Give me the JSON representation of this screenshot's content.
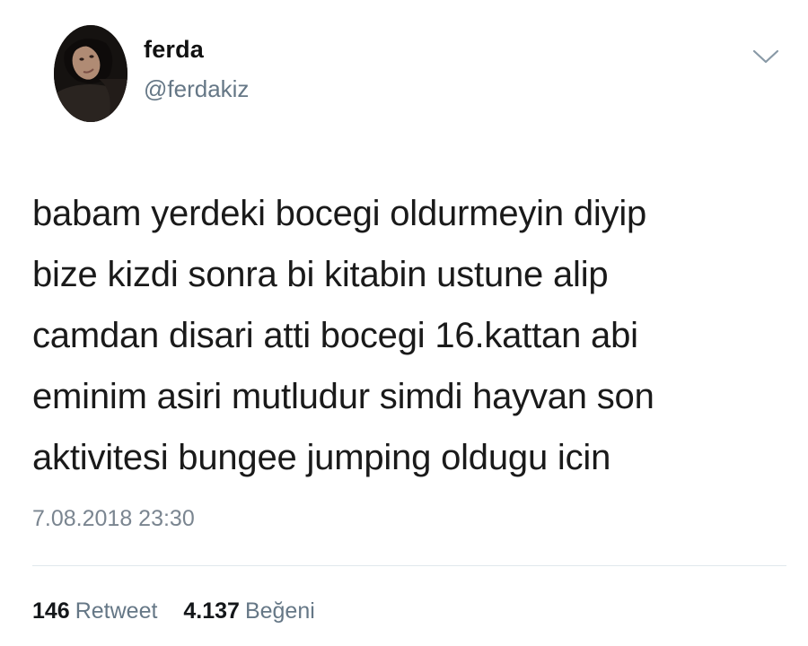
{
  "author": {
    "display_name": "ferda",
    "handle": "@ferdakiz",
    "avatar_icon": "profile-photo"
  },
  "menu": {
    "icon": "chevron-down-icon"
  },
  "tweet": {
    "lines": [
      "babam yerdeki bocegi oldurmeyin diyip",
      "bize kizdi sonra bi kitabin ustune alip",
      "camdan disari atti bocegi 16.kattan abi",
      "eminim asiri mutludur simdi hayvan son",
      "aktivitesi bungee jumping oldugu icin"
    ],
    "timestamp": "7.08.2018 23:30"
  },
  "stats": {
    "retweet_count": "146",
    "retweet_label": "Retweet",
    "like_count": "4.137",
    "like_label": "Beğeni"
  },
  "colors": {
    "secondary_text": "#657786",
    "divider": "#e1e8ed"
  }
}
